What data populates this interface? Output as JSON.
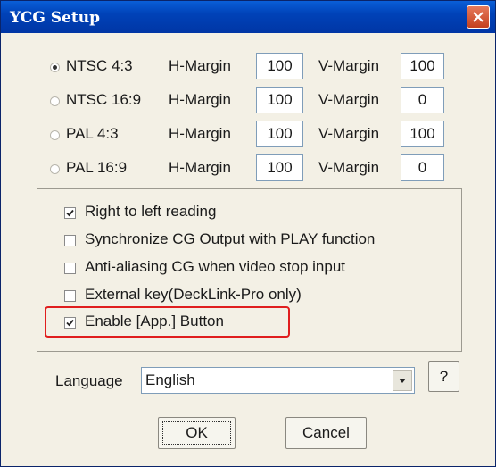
{
  "window": {
    "title": "YCG Setup"
  },
  "formats": [
    {
      "label": "NTSC 4:3",
      "selected": true,
      "h_label": "H-Margin",
      "h_value": "100",
      "v_label": "V-Margin",
      "v_value": "100"
    },
    {
      "label": "NTSC 16:9",
      "selected": false,
      "h_label": "H-Margin",
      "h_value": "100",
      "v_label": "V-Margin",
      "v_value": "0"
    },
    {
      "label": "PAL 4:3",
      "selected": false,
      "h_label": "H-Margin",
      "h_value": "100",
      "v_label": "V-Margin",
      "v_value": "100"
    },
    {
      "label": "PAL 16:9",
      "selected": false,
      "h_label": "H-Margin",
      "h_value": "100",
      "v_label": "V-Margin",
      "v_value": "0"
    }
  ],
  "options": [
    {
      "label": "Right to left reading",
      "checked": true
    },
    {
      "label": "Synchronize CG Output with PLAY function",
      "checked": false
    },
    {
      "label": "Anti-aliasing CG when video stop input",
      "checked": false
    },
    {
      "label": "External key(DeckLink-Pro only)",
      "checked": false
    },
    {
      "label": "Enable [App.] Button",
      "checked": true
    }
  ],
  "language": {
    "label": "Language",
    "value": "English",
    "help_label": "?"
  },
  "buttons": {
    "ok": "OK",
    "cancel": "Cancel"
  },
  "colors": {
    "title_bar": "#0042b8",
    "highlight": "#e01e1e",
    "close_button": "#c4401e"
  },
  "icons": {
    "close": "close-icon",
    "dropdown": "chevron-down-icon",
    "check": "check-icon"
  }
}
